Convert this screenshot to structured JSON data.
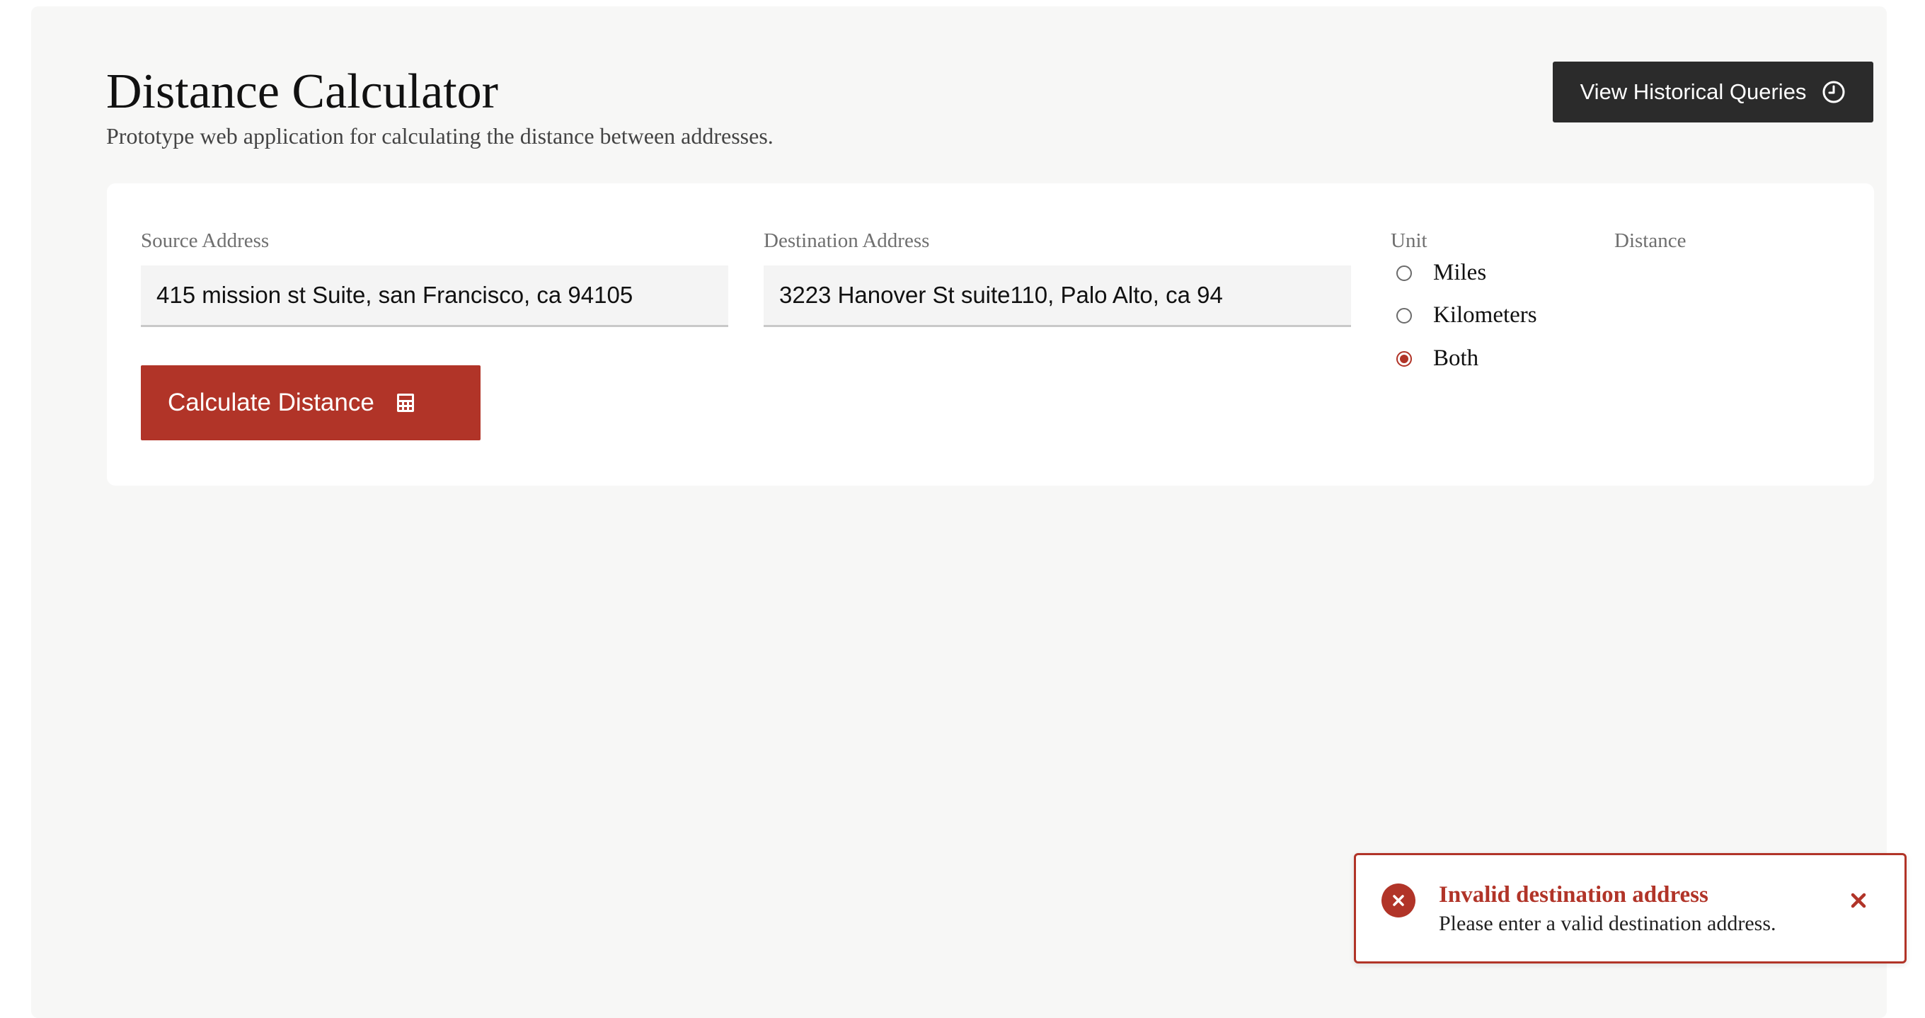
{
  "header": {
    "title": "Distance Calculator",
    "subtitle": "Prototype web application for calculating the distance between addresses.",
    "history_button_label": "View Historical Queries",
    "history_icon": "clock-icon"
  },
  "form": {
    "source_label": "Source Address",
    "source_value": "415 mission st Suite, san Francisco, ca 94105",
    "destination_label": "Destination Address",
    "destination_value": "3223 Hanover St suite110, Palo Alto, ca 94",
    "calculate_button_label": "Calculate Distance",
    "calculate_icon": "calculator-icon",
    "unit_label": "Unit",
    "unit_options": [
      {
        "label": "Miles",
        "selected": false
      },
      {
        "label": "Kilometers",
        "selected": false
      },
      {
        "label": "Both",
        "selected": true
      }
    ],
    "distance_label": "Distance"
  },
  "toast": {
    "title": "Invalid destination address",
    "message": "Please enter a valid destination address.",
    "icon": "error-circle-icon",
    "close_icon": "close-icon"
  },
  "colors": {
    "accent": "#b13428",
    "dark_button": "#2b2b2b",
    "page_background": "#f7f7f6",
    "card_background": "#ffffff"
  }
}
